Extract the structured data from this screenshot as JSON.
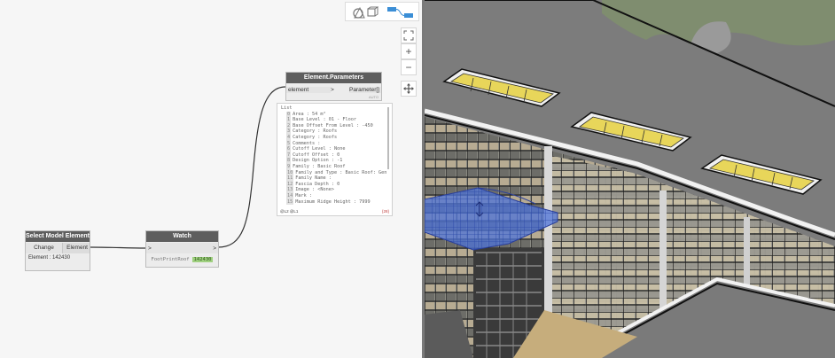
{
  "toolbar": {
    "geometry_toggle_icon": "geometry-preview-icon",
    "graph_toggle_icon": "graph-preview-icon"
  },
  "zoom_controls": {
    "fit_icon": "fit-view-icon",
    "zoom_in": "+",
    "zoom_out": "−",
    "pan_icon": "pan-icon"
  },
  "nodes": {
    "select_model": {
      "title": "Select Model Element",
      "change_button": "Change",
      "output_port": "Element",
      "status": "Element : 142430"
    },
    "watch": {
      "title": "Watch",
      "input_port": ">",
      "output_port": ">",
      "value_label": "FootPrintRoof",
      "value_id": "142430"
    },
    "element_parameters": {
      "title": "Element.Parameters",
      "input_port": "element",
      "input_arrow": ">",
      "output_port": "Parameter[]",
      "lacing": "AUTO",
      "list_header": "List",
      "items": [
        {
          "index": "0",
          "text": "Area : 54 m²"
        },
        {
          "index": "1",
          "text": "Base Level : 01 - Floor"
        },
        {
          "index": "2",
          "text": "Base Offset From Level : -450"
        },
        {
          "index": "3",
          "text": "Category : Roofs"
        },
        {
          "index": "4",
          "text": "Category : Roofs"
        },
        {
          "index": "5",
          "text": "Comments :"
        },
        {
          "index": "6",
          "text": "Cutoff Level : None"
        },
        {
          "index": "7",
          "text": "Cutoff Offset : 0"
        },
        {
          "index": "8",
          "text": "Design Option : -1"
        },
        {
          "index": "9",
          "text": "Family : Basic Roof"
        },
        {
          "index": "10",
          "text": "Family and Type : Basic Roof: Gen"
        },
        {
          "index": "11",
          "text": "Family Name :"
        },
        {
          "index": "12",
          "text": "Fascia Depth : 0"
        },
        {
          "index": "13",
          "text": "Image : <None>"
        },
        {
          "index": "14",
          "text": "Mark :"
        },
        {
          "index": "15",
          "text": "Maximum Ridge Height : 7999"
        }
      ],
      "footer_level": "@L2 @L1",
      "footer_count": "{28}"
    }
  },
  "colors": {
    "node_header": "#5e5e5e",
    "canvas_bg": "#f6f6f6",
    "watch_highlight": "#9fd07f",
    "selection_blue": "#3b62d6",
    "skylight_yellow": "#e8d65a"
  }
}
